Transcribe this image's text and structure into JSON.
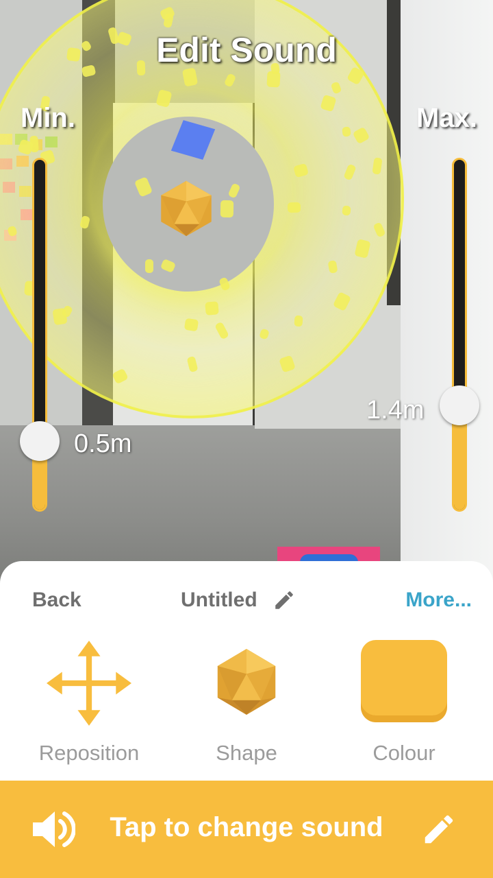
{
  "screen": {
    "title": "Edit Sound"
  },
  "sliders": {
    "min": {
      "label": "Min.",
      "value_text": "0.5m",
      "level": 0.2
    },
    "max": {
      "label": "Max.",
      "value_text": "1.4m",
      "level": 0.3
    }
  },
  "panel": {
    "back_label": "Back",
    "sound_name": "Untitled",
    "more_label": "More...",
    "tools": [
      {
        "label": "Reposition",
        "icon": "move-arrows-icon"
      },
      {
        "label": "Shape",
        "icon": "icosahedron-icon"
      },
      {
        "label": "Colour",
        "icon": "colour-swatch"
      }
    ]
  },
  "sound_bar": {
    "label": "Tap to change sound",
    "left_icon": "speaker-icon",
    "right_icon": "pencil-icon"
  },
  "colors": {
    "accent": "#f8bd3e",
    "more_link": "#3aa4c9",
    "label_grey": "#6f6f6f",
    "sphere": "#f2ee5c",
    "selected_colour": "#f8bd3e"
  }
}
